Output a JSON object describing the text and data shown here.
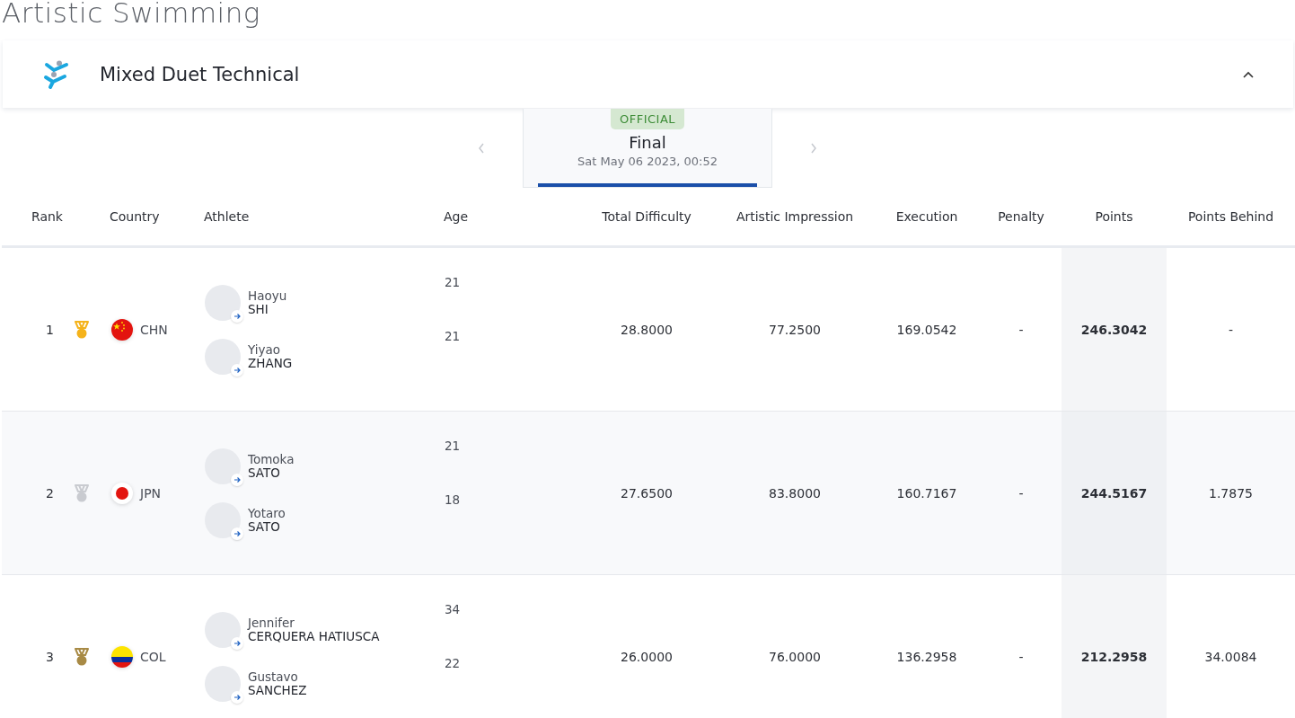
{
  "title": "Artistic Swimming",
  "event": {
    "name": "Mixed Duet Technical",
    "expanded": true
  },
  "phase": {
    "status": "OFFICIAL",
    "name": "Final",
    "date": "Sat May 06 2023, 00:52"
  },
  "table": {
    "columns": [
      "Rank",
      "Country",
      "Athlete",
      "Age",
      "Total Difficulty",
      "Artistic Impression",
      "Execution",
      "Penalty",
      "Points",
      "Points Behind"
    ],
    "rows": [
      {
        "rank": "1",
        "medal": {
          "kind": "gold"
        },
        "flag": {
          "kind": "china"
        },
        "country": "CHN",
        "athletes": [
          {
            "first": "Haoyu",
            "last": "SHI",
            "age": "21"
          },
          {
            "first": "Yiyao",
            "last": "ZHANG",
            "age": "21"
          }
        ],
        "total_difficulty": "28.8000",
        "artistic_impression": "77.2500",
        "execution": "169.0542",
        "penalty": "-",
        "points": "246.3042",
        "points_behind": "-"
      },
      {
        "rank": "2",
        "medal": {
          "kind": "silver"
        },
        "flag": {
          "kind": "japan"
        },
        "country": "JPN",
        "athletes": [
          {
            "first": "Tomoka",
            "last": "SATO",
            "age": "21"
          },
          {
            "first": "Yotaro",
            "last": "SATO",
            "age": "18"
          }
        ],
        "total_difficulty": "27.6500",
        "artistic_impression": "83.8000",
        "execution": "160.7167",
        "penalty": "-",
        "points": "244.5167",
        "points_behind": "1.7875"
      },
      {
        "rank": "3",
        "medal": {
          "kind": "bronze"
        },
        "flag": {
          "kind": "colombia"
        },
        "country": "COL",
        "athletes": [
          {
            "first": "Jennifer",
            "last": "CERQUERA HATIUSCA",
            "age": "34"
          },
          {
            "first": "Gustavo",
            "last": "SANCHEZ",
            "age": "22"
          }
        ],
        "total_difficulty": "26.0000",
        "artistic_impression": "76.0000",
        "execution": "136.2958",
        "penalty": "-",
        "points": "212.2958",
        "points_behind": "34.0084"
      }
    ]
  }
}
